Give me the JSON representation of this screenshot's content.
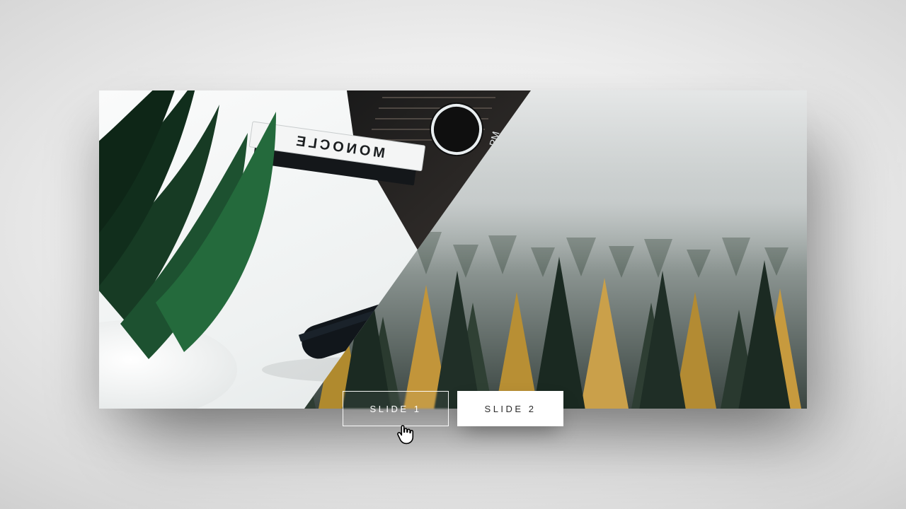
{
  "slider": {
    "buttons": [
      {
        "label": "SLIDE 1",
        "state": "hover-outline"
      },
      {
        "label": "SLIDE 2",
        "state": "solid"
      }
    ],
    "slides": [
      {
        "name": "desk-workspace",
        "description": "White desk with green plant, stacked MONOCLE books, laptop corner showing clock with PM label, and dark watch band"
      },
      {
        "name": "foggy-forest",
        "description": "Misty mountain slope of evergreen and autumn gold conifers under grey fog"
      }
    ]
  },
  "misc": {
    "book_title": "MONOCLE",
    "clock_suffix": "PM"
  }
}
